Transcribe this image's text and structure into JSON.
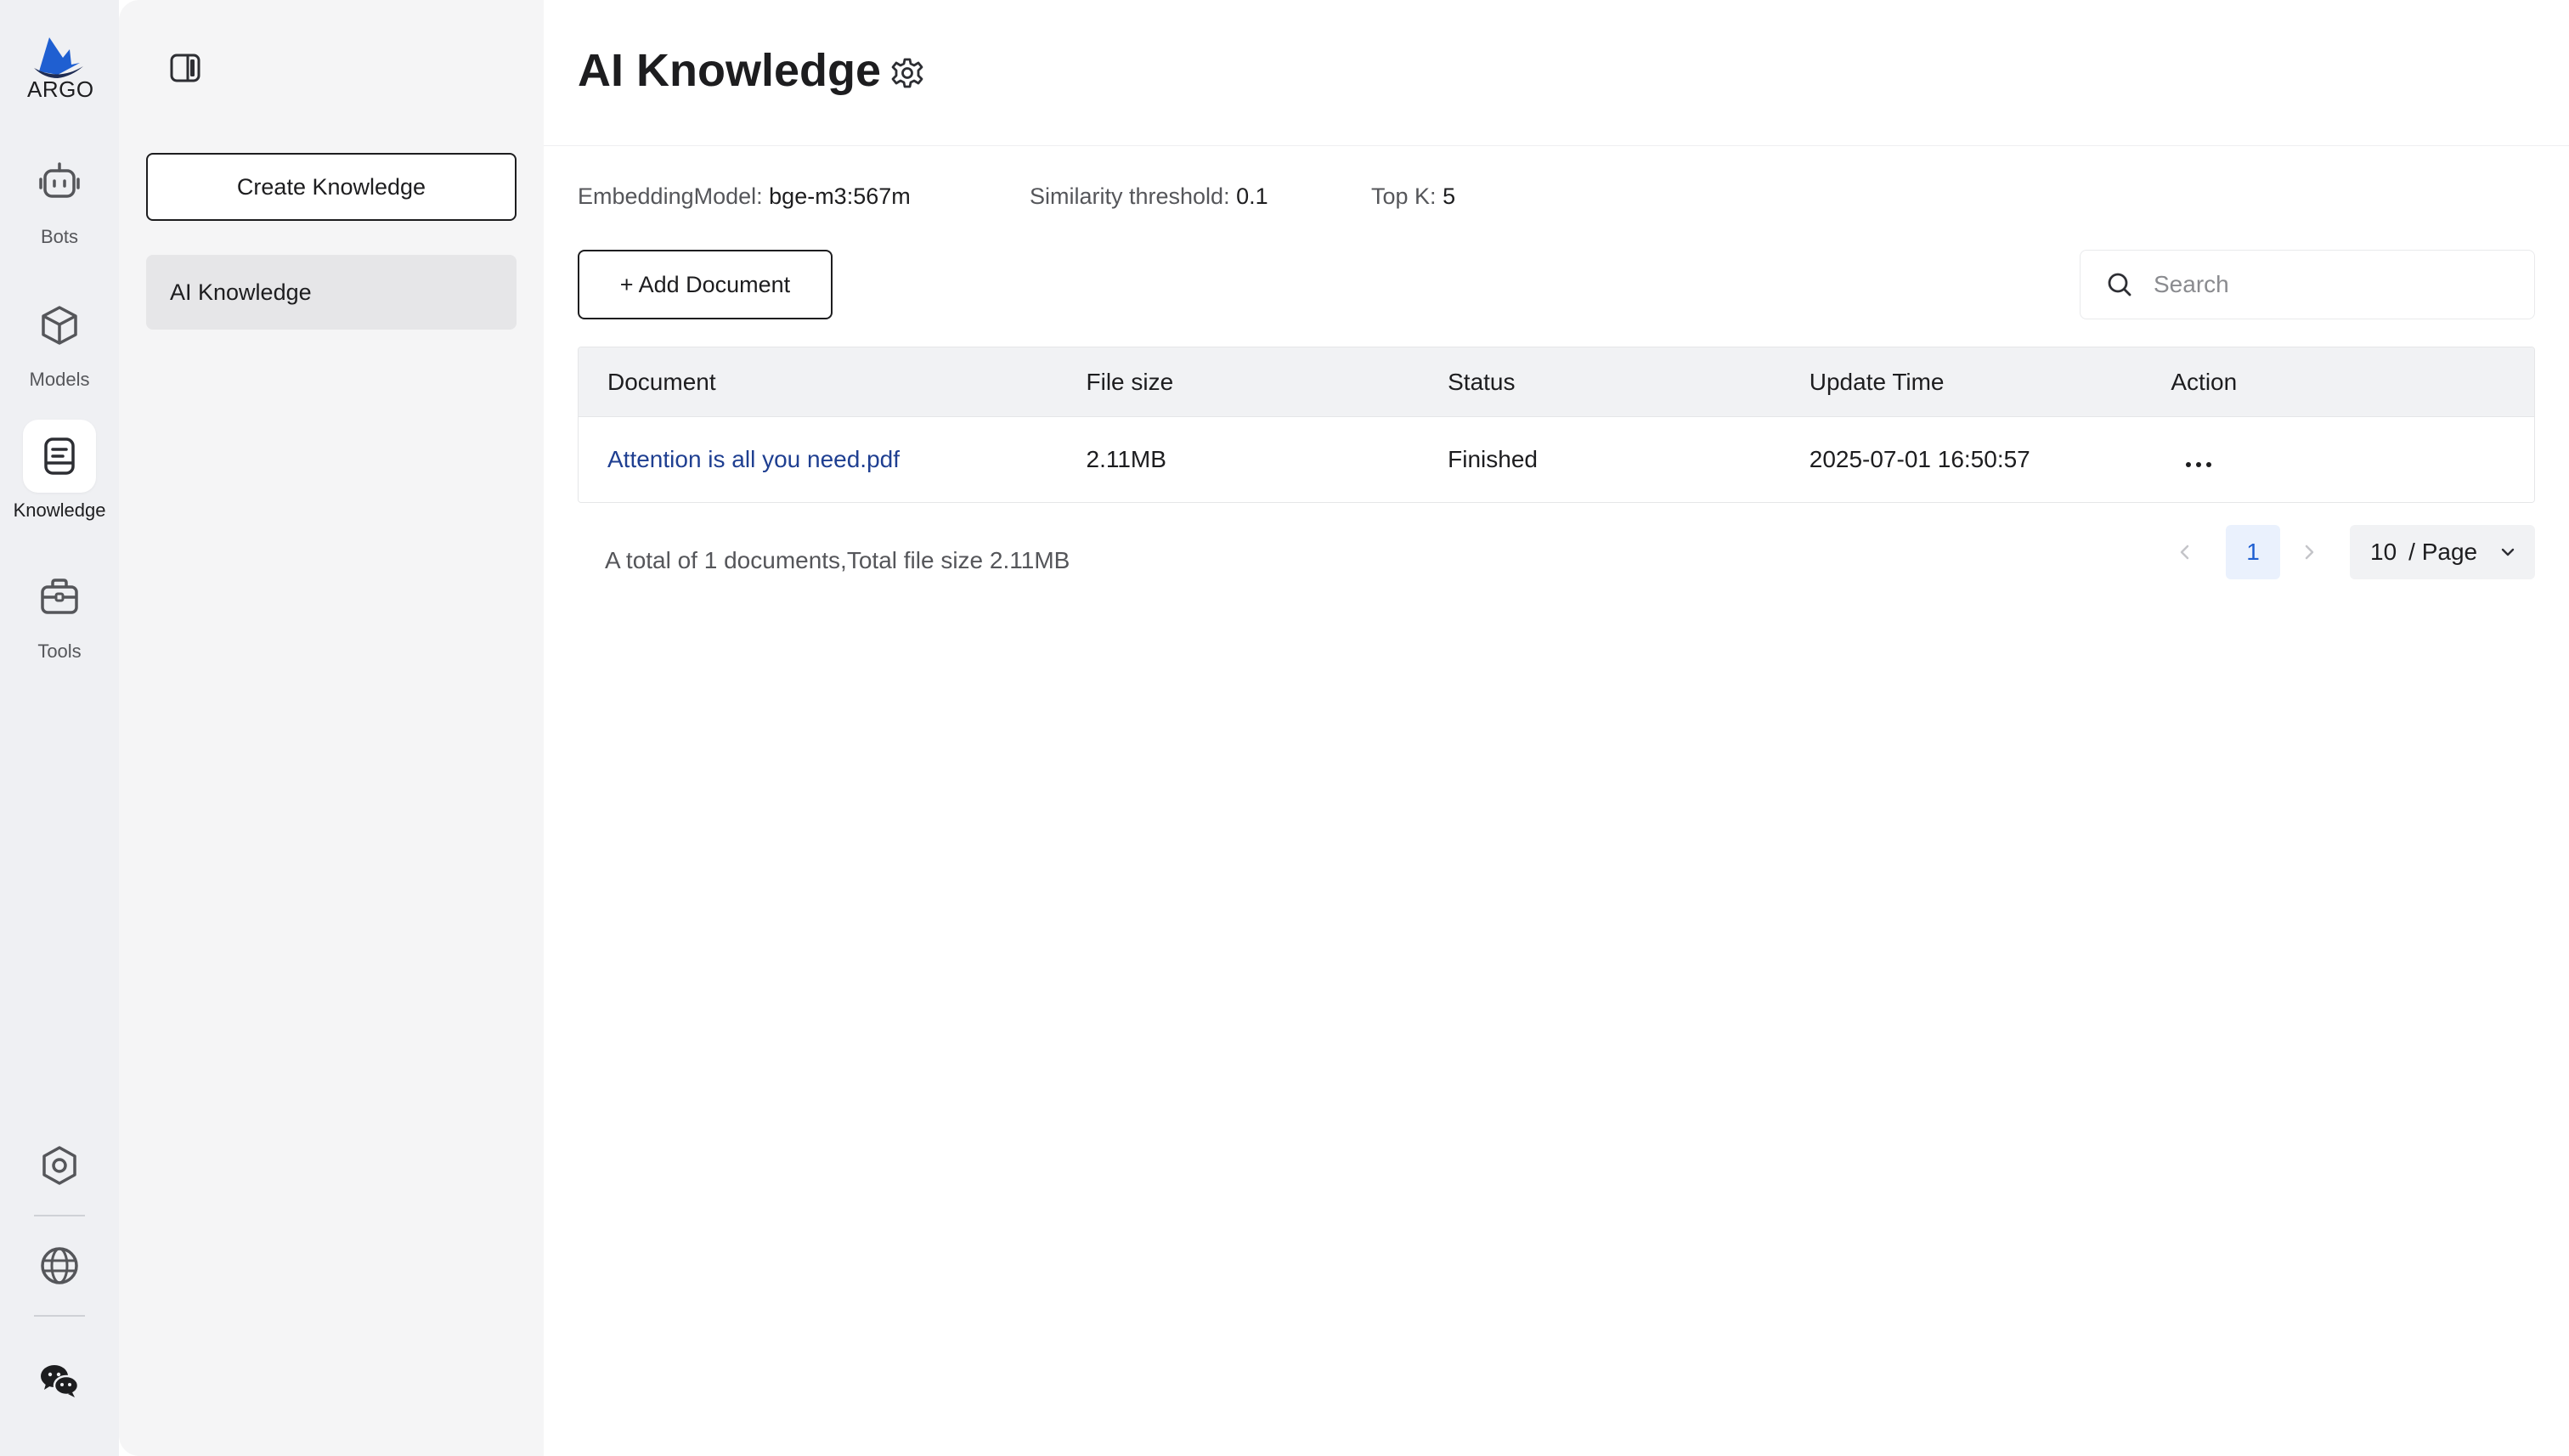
{
  "rail": {
    "logo_text": "ARGO",
    "items": [
      {
        "label": "Bots",
        "icon": "bot-icon"
      },
      {
        "label": "Models",
        "icon": "cube-icon"
      },
      {
        "label": "Knowledge",
        "icon": "knowledge-icon",
        "active": true
      },
      {
        "label": "Tools",
        "icon": "toolbox-icon"
      }
    ],
    "bottom_icons": [
      "settings-hex-icon",
      "globe-icon",
      "wechat-icon"
    ]
  },
  "panel": {
    "create_label": "Create Knowledge",
    "items": [
      {
        "label": "AI Knowledge",
        "active": true
      }
    ]
  },
  "main": {
    "title": "AI Knowledge",
    "meta": {
      "embedding_label": "EmbeddingModel:",
      "embedding_value": "bge-m3:567m",
      "similarity_label": "Similarity threshold:",
      "similarity_value": "0.1",
      "topk_label": "Top K:",
      "topk_value": "5"
    },
    "add_document_label": "+ Add Document",
    "search": {
      "placeholder": "Search",
      "value": ""
    },
    "table": {
      "columns": [
        "Document",
        "File size",
        "Status",
        "Update Time",
        "Action"
      ],
      "rows": [
        {
          "document": "Attention is all you need.pdf",
          "file_size": "2.11MB",
          "status": "Finished",
          "update_time": "2025-07-01 16:50:57"
        }
      ]
    },
    "footer": {
      "total_text": "A total of 1 documents,Total file size 2.11MB",
      "current_page": "1",
      "page_size": "10",
      "page_size_suffix": "/ Page"
    }
  },
  "colors": {
    "rail_bg": "#eff0f3",
    "panel_bg": "#f5f5f6",
    "link": "#1f3f91",
    "page_active_bg": "#eaf1fd",
    "page_active_text": "#1f5fd1"
  }
}
